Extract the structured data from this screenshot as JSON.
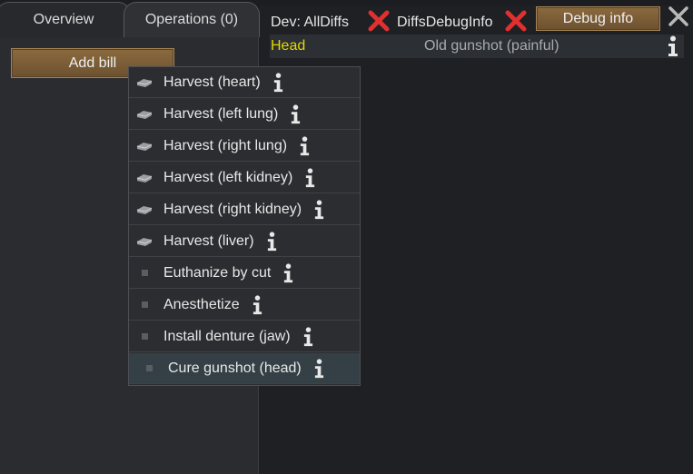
{
  "tabs": {
    "overview_label": "Overview",
    "operations_label": "Operations (0)"
  },
  "left": {
    "add_bill_label": "Add bill"
  },
  "header": {
    "dev_all_diffs_label": "Dev: AllDiffs",
    "diffs_debug_info_label": "DiffsDebugInfo",
    "debug_info_button_label": "Debug info"
  },
  "hediff": {
    "part": "Head",
    "description": "Old gunshot (painful)"
  },
  "menu": {
    "items": [
      {
        "label": "Harvest (heart)",
        "icon": "organ-icon"
      },
      {
        "label": "Harvest (left lung)",
        "icon": "organ-icon"
      },
      {
        "label": "Harvest (right lung)",
        "icon": "organ-icon"
      },
      {
        "label": "Harvest (left kidney)",
        "icon": "organ-icon"
      },
      {
        "label": "Harvest (right kidney)",
        "icon": "organ-icon"
      },
      {
        "label": "Harvest (liver)",
        "icon": "organ-icon"
      },
      {
        "label": "Euthanize by cut",
        "icon": "dot-icon"
      },
      {
        "label": "Anesthetize",
        "icon": "dot-icon"
      },
      {
        "label": "Install denture (jaw)",
        "icon": "dot-icon"
      },
      {
        "label": "Cure gunshot (head)",
        "icon": "dot-icon",
        "highlighted": true
      }
    ]
  },
  "colors": {
    "part_label": "#e6d800",
    "accent_red": "#e03030",
    "button_wood": "#7a5c36"
  }
}
